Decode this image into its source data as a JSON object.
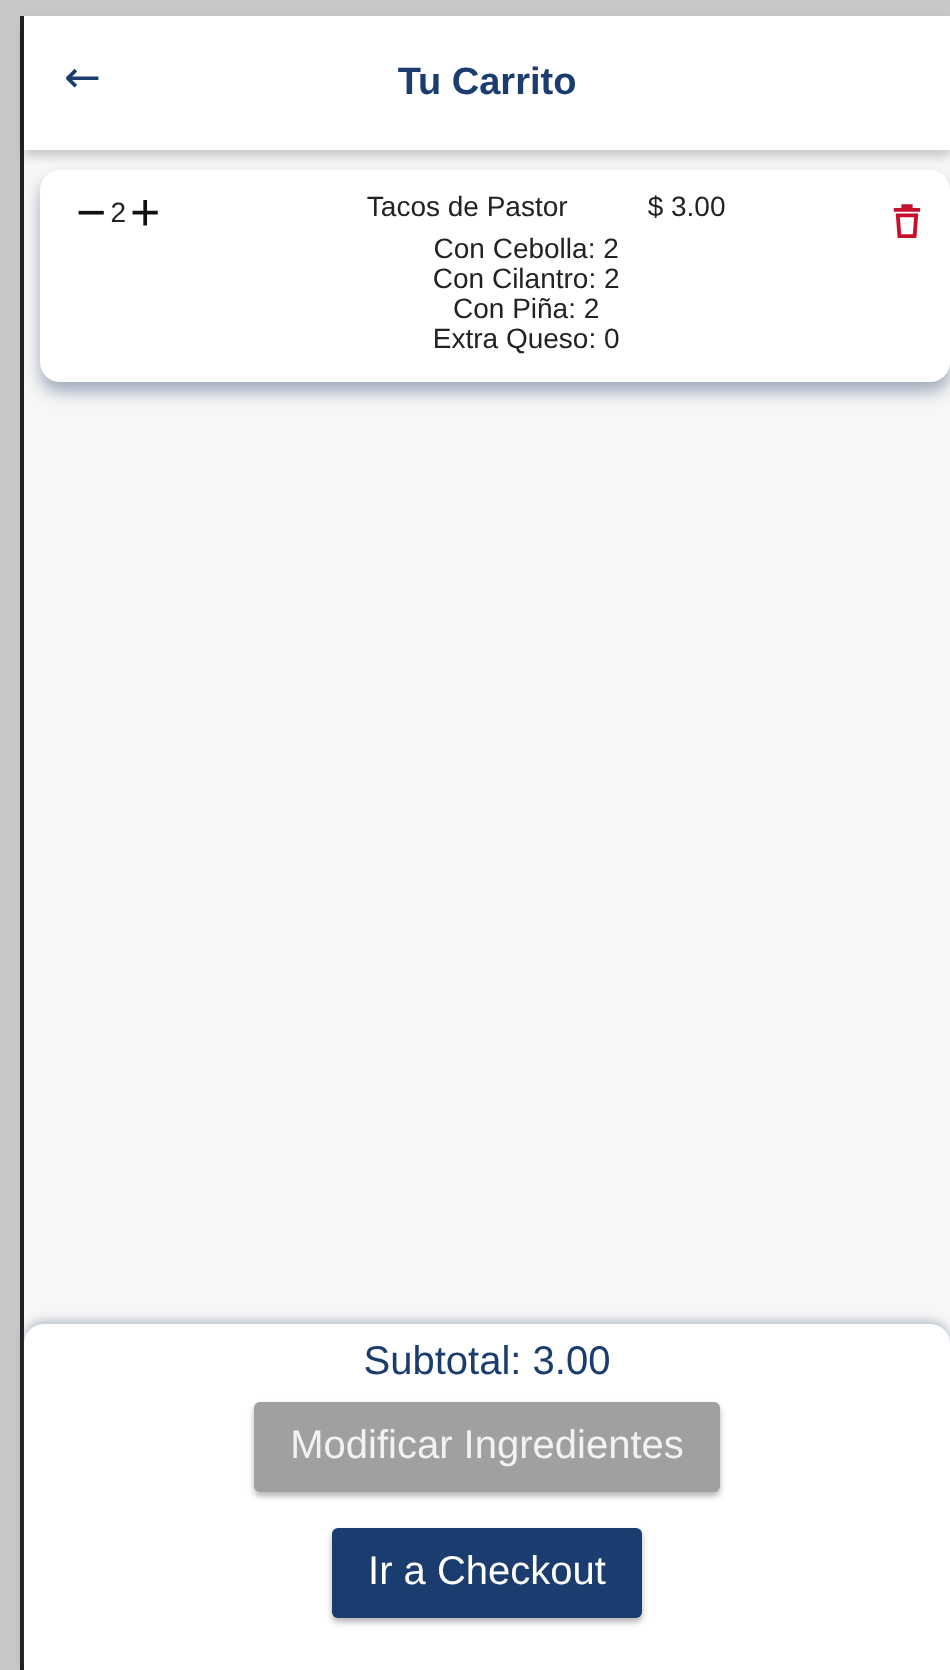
{
  "header": {
    "back_icon": "←",
    "title": "Tu Carrito"
  },
  "cart_items": [
    {
      "minus": "−",
      "quantity": "2",
      "plus": "+",
      "name": "Tacos de Pastor",
      "price": "$ 3.00",
      "options": [
        "Con Cebolla: 2",
        "Con Cilantro: 2",
        "Con Piña: 2",
        "Extra Queso: 0"
      ]
    }
  ],
  "footer": {
    "subtotal": "Subtotal: 3.00",
    "buttons": [
      {
        "label": "Modificar Ingredientes",
        "disabled": true
      },
      {
        "label": "Ir a Checkout",
        "disabled": false
      }
    ]
  }
}
